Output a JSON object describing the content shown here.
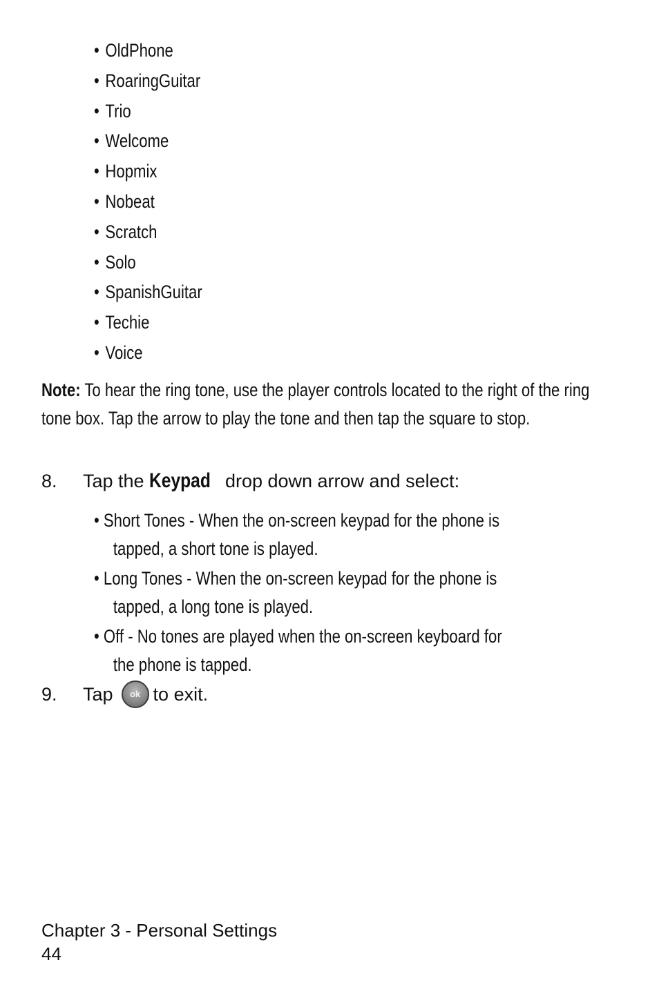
{
  "ringtone_list": [
    "OldPhone",
    "RoaringGuitar",
    "Trio",
    "Welcome",
    "Hopmix",
    "Nobeat",
    "Scratch",
    "Solo",
    "SpanishGuitar",
    "Techie",
    "Voice"
  ],
  "bullet_char": "•",
  "note": {
    "label": "Note:",
    "text": " To hear the ring tone, use the player controls located to the right of the ring tone box. Tap the arrow to play the tone and then tap the square to stop."
  },
  "step8": {
    "number": "8.",
    "prefix": "Tap the ",
    "keyword": "Keypad",
    "suffix": " drop down arrow and select:",
    "options": [
      {
        "line1": "Short Tones - When the on-screen keypad for the phone is",
        "line2": "tapped, a short tone is played."
      },
      {
        "line1": "Long Tones - When the on-screen keypad for the phone is",
        "line2": "tapped, a long tone is played."
      },
      {
        "line1": "Off - No tones are played when the on-screen keyboard for",
        "line2": "the phone is tapped."
      }
    ]
  },
  "step9": {
    "number": "9.",
    "prefix": "Tap",
    "icon_label": "ok",
    "suffix": "to exit."
  },
  "footer": {
    "chapter": "Chapter 3 - Personal Settings",
    "page_number": "44"
  }
}
